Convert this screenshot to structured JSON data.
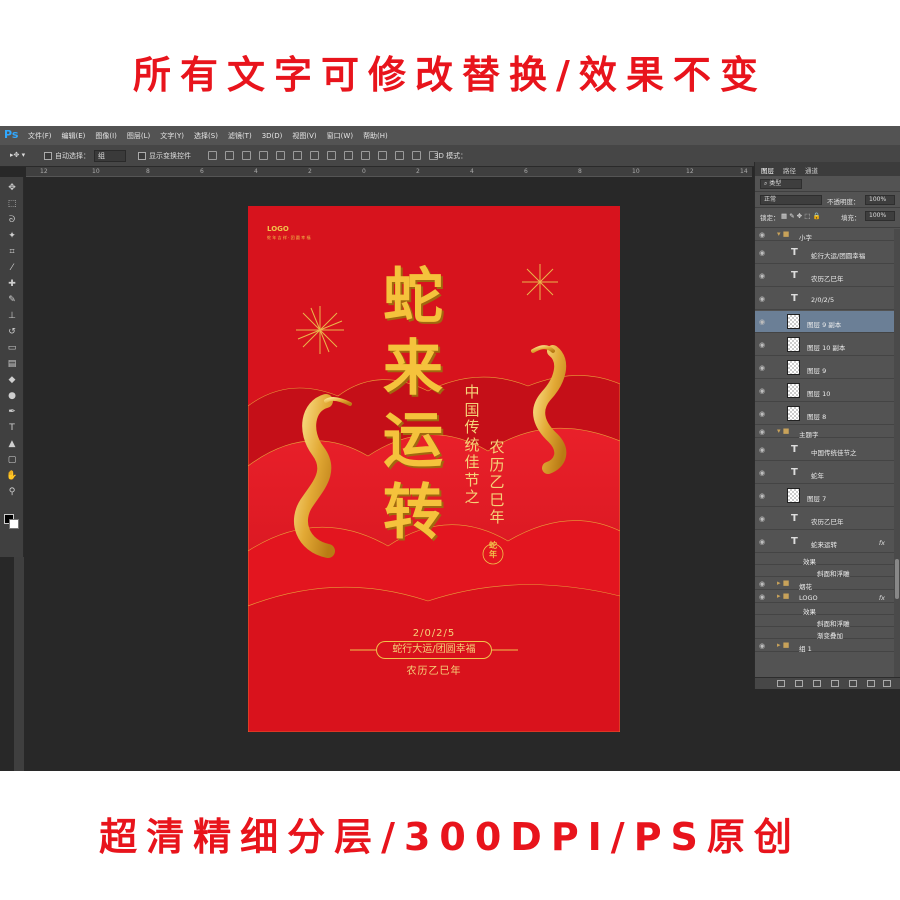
{
  "banner_top": "所有文字可修改替换/效果不变",
  "banner_bottom": "超清精细分层/300DPI/PS原创",
  "app": {
    "logo": "Ps",
    "menu": [
      "文件(F)",
      "编辑(E)",
      "图像(I)",
      "图层(L)",
      "文字(Y)",
      "选择(S)",
      "滤镜(T)",
      "3D(D)",
      "视图(V)",
      "窗口(W)",
      "帮助(H)"
    ]
  },
  "options": {
    "auto_select_label": "自动选择：",
    "auto_select_value": "组",
    "show_transform_label": "显示变换控件",
    "mode_3d_label": "3D 模式："
  },
  "poster": {
    "logo": "LOGO",
    "logo_sub": "蛇 年 吉 祥 · 团 圆 幸 福",
    "title": [
      "蛇",
      "来",
      "运",
      "转"
    ],
    "vertical_1": [
      "中",
      "国",
      "传",
      "统",
      "佳",
      "节",
      "之"
    ],
    "vertical_2": [
      "农",
      "历",
      "乙",
      "巳",
      "年"
    ],
    "seal": [
      "蛇",
      "年"
    ],
    "date": "2/0/2/5",
    "slogan": "蛇行大运/团圆幸福",
    "lunar_year": "农历乙巳年"
  },
  "panel": {
    "tabs": [
      "图层",
      "路径",
      "通道"
    ],
    "kind_label": "类型",
    "blend_mode": "正常",
    "opacity_label": "不透明度：",
    "opacity_value": "100%",
    "lock_label": "锁定：",
    "fill_label": "填充：",
    "fill_value": "100%",
    "layers": [
      {
        "name": "小字",
        "kind": "group",
        "open": true
      },
      {
        "name": "蛇行大运/团圆幸福",
        "kind": "text"
      },
      {
        "name": "农历乙巳年",
        "kind": "text"
      },
      {
        "name": "2/0/2/5",
        "kind": "text"
      },
      {
        "name": "图层 9 副本",
        "kind": "image",
        "selected": true
      },
      {
        "name": "图层 10 副本",
        "kind": "image"
      },
      {
        "name": "图层 9",
        "kind": "image"
      },
      {
        "name": "图层 10",
        "kind": "image"
      },
      {
        "name": "图层 8",
        "kind": "image"
      },
      {
        "name": "主题字",
        "kind": "group",
        "open": true
      },
      {
        "name": "中国传统佳节之",
        "kind": "text"
      },
      {
        "name": "蛇年",
        "kind": "text"
      },
      {
        "name": "图层 7",
        "kind": "image"
      },
      {
        "name": "农历乙巳年",
        "kind": "text"
      },
      {
        "name": "蛇来运转",
        "kind": "text",
        "fx": true
      },
      {
        "name": "效果",
        "kind": "effect-header"
      },
      {
        "name": "斜面和浮雕",
        "kind": "effect"
      },
      {
        "name": "烟花",
        "kind": "group"
      },
      {
        "name": "LOGO",
        "kind": "group",
        "fx": true
      },
      {
        "name": "效果",
        "kind": "effect-header"
      },
      {
        "name": "斜面和浮雕",
        "kind": "effect"
      },
      {
        "name": "渐变叠加",
        "kind": "effect"
      },
      {
        "name": "组 1",
        "kind": "group"
      }
    ]
  },
  "colors": {
    "banner_red": "#e8141c",
    "poster_red": "#d7131d",
    "gold": "#f5c23c",
    "ps_dark": "#282828",
    "ps_panel": "#535353",
    "selection_blue": "#6b7f96"
  }
}
